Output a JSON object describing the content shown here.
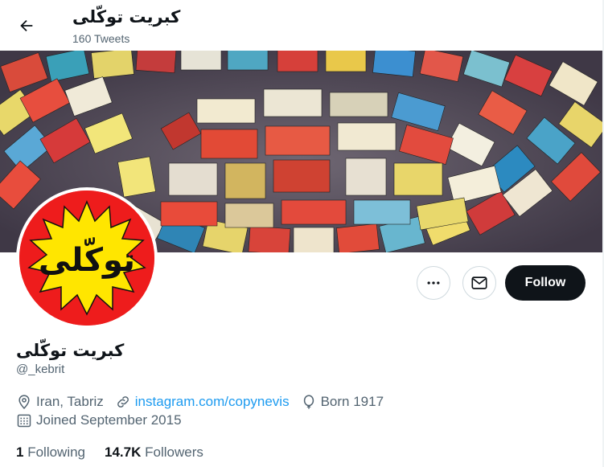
{
  "header": {
    "title": "کبریت توکّلی",
    "tweet_count": "160 Tweets"
  },
  "profile": {
    "display_name": "کبریت توکّلی",
    "handle": "@_kebrit",
    "avatar_text": "توکّلی",
    "location": "Iran, Tabriz",
    "website": "instagram.com/copynevis",
    "born": "Born 1917",
    "joined": "Joined September 2015"
  },
  "actions": {
    "follow_label": "Follow"
  },
  "stats": {
    "following_count": "1",
    "following_label": "Following",
    "followers_count": "14.7K",
    "followers_label": "Followers"
  },
  "colors": {
    "accent": "#1d9bf0",
    "avatar_bg": "#ee1c1c",
    "avatar_star": "#ffe600",
    "button_dark": "#0f1419"
  },
  "icons": [
    "back-arrow-icon",
    "more-icon",
    "mail-icon",
    "location-icon",
    "link-icon",
    "balloon-icon",
    "calendar-icon"
  ]
}
